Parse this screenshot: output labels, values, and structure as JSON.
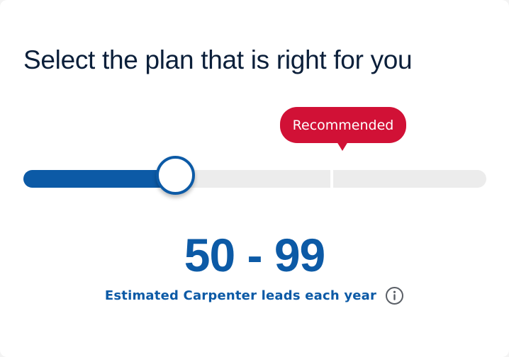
{
  "title": "Select the plan that is right for you",
  "recommended_label": "Recommended",
  "slider": {
    "value_fraction": 0.33,
    "segments": 2
  },
  "range_value": "50 - 99",
  "caption": "Estimated Carpenter leads each year",
  "icons": {
    "info": "info-circle-icon"
  },
  "colors": {
    "primary_blue": "#0c5aa6",
    "recommended_red": "#d11136",
    "track_gray": "#ececec",
    "title_navy": "#0b1f3a"
  }
}
